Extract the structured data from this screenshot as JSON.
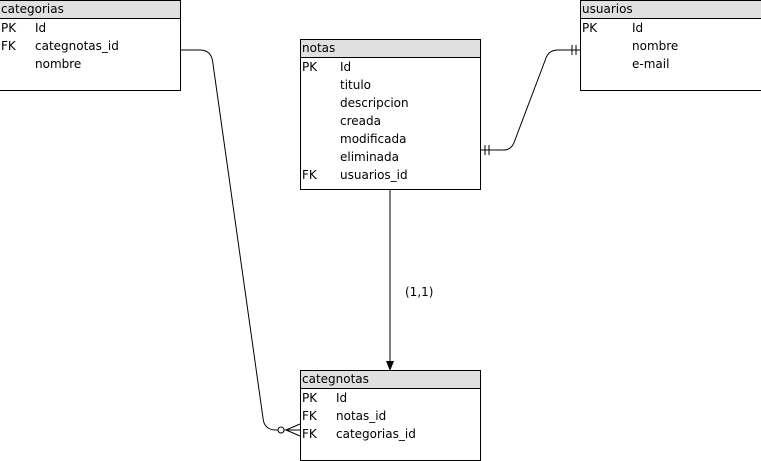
{
  "entities": {
    "categorias": {
      "title": "categorias",
      "rows": [
        {
          "key": "PK",
          "name": "Id"
        },
        {
          "key": "FK",
          "name": "categnotas_id"
        },
        {
          "key": "",
          "name": "nombre"
        }
      ]
    },
    "usuarios": {
      "title": "usuarios",
      "rows": [
        {
          "key": "PK",
          "name": "Id"
        },
        {
          "key": "",
          "name": "nombre"
        },
        {
          "key": "",
          "name": "e-mail"
        }
      ]
    },
    "notas": {
      "title": "notas",
      "rows": [
        {
          "key": "PK",
          "name": "Id"
        },
        {
          "key": "",
          "name": "titulo"
        },
        {
          "key": "",
          "name": "descripcion"
        },
        {
          "key": "",
          "name": "creada"
        },
        {
          "key": "",
          "name": "modificada"
        },
        {
          "key": "",
          "name": "eliminada"
        },
        {
          "key": "FK",
          "name": "usuarios_id"
        }
      ]
    },
    "categnotas": {
      "title": "categnotas",
      "rows": [
        {
          "key": "PK",
          "name": "Id"
        },
        {
          "key": "FK",
          "name": "notas_id"
        },
        {
          "key": "FK",
          "name": "categorias_id"
        }
      ]
    }
  },
  "relationships": {
    "notas_categnotas_label": "(1,1)"
  }
}
